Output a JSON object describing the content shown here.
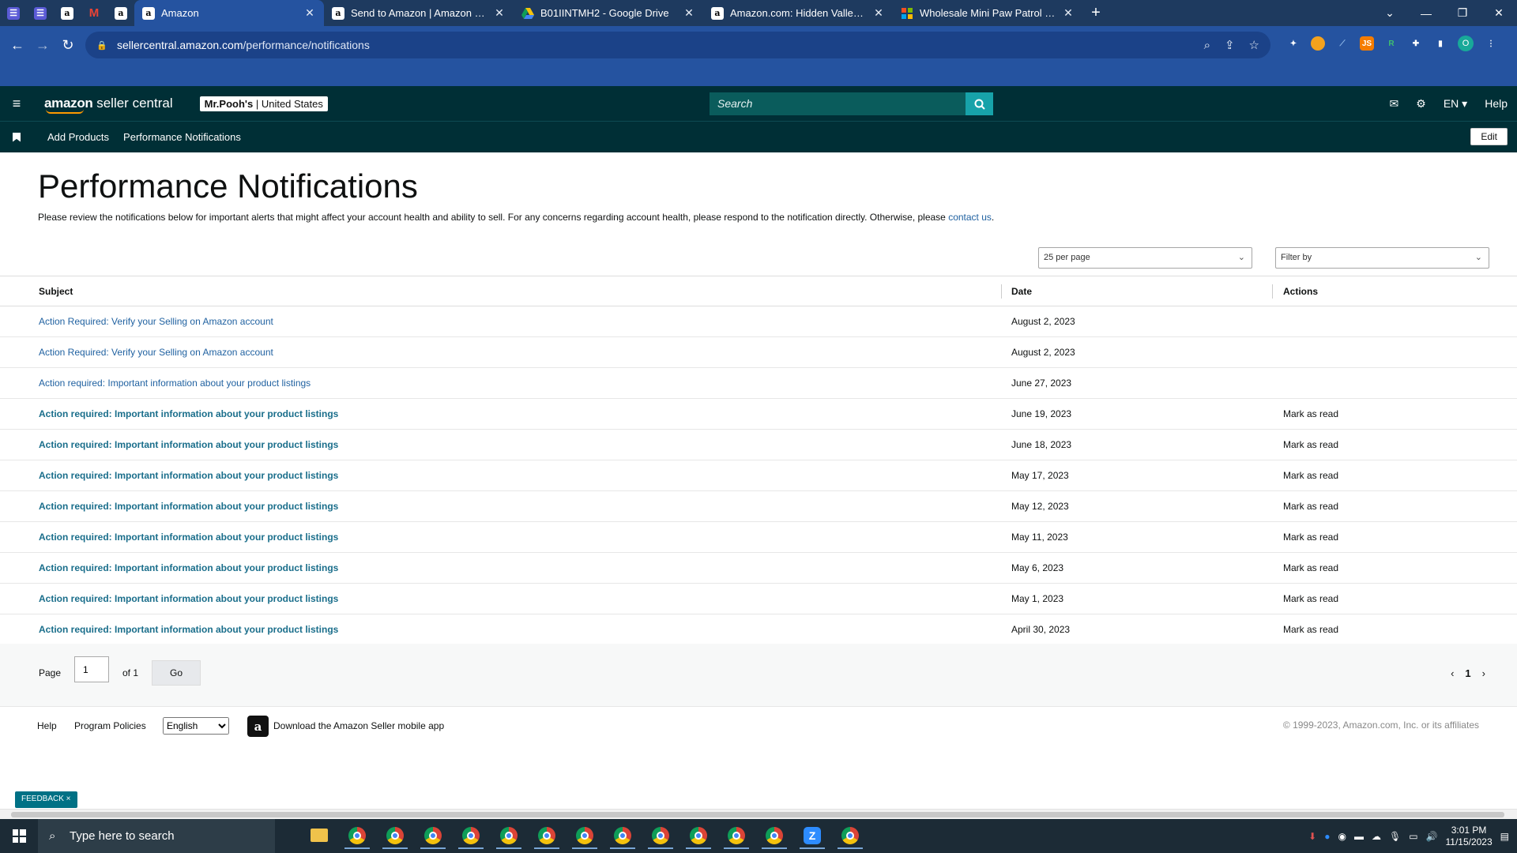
{
  "browser": {
    "tabs": [
      {
        "title": "Amazon",
        "favicon": "amazon-icon",
        "active": true
      },
      {
        "title": "Send to Amazon | Amazon Seller",
        "favicon": "amazon-icon"
      },
      {
        "title": "B01IINTMH2 - Google Drive",
        "favicon": "google-drive-icon"
      },
      {
        "title": "Amazon.com: Hidden Valley, Ran",
        "favicon": "amazon-icon"
      },
      {
        "title": "Wholesale Mini Paw Patrol Guita",
        "favicon": "microsoft-icon"
      }
    ],
    "url_host": "sellercentral.amazon.com",
    "url_path": "/performance/notifications"
  },
  "header": {
    "logo_bold": "amazon",
    "logo_rest": " seller central",
    "store_name": "Mr.Pooh's",
    "store_region": " | United States",
    "search_placeholder": "Search",
    "language": "EN ▾",
    "help": "Help"
  },
  "subnav": {
    "links": [
      "Add Products",
      "Performance Notifications"
    ],
    "edit": "Edit"
  },
  "page": {
    "title": "Performance Notifications",
    "description": "Please review the notifications below for important alerts that might affect your account health and ability to sell. For any concerns regarding account health, please respond to the notification directly. Otherwise, please ",
    "contact_link": "contact us",
    "description_end": "."
  },
  "controls": {
    "per_page": "25 per page",
    "filter": "Filter by"
  },
  "table": {
    "headers": {
      "subject": "Subject",
      "date": "Date",
      "actions": "Actions"
    },
    "rows": [
      {
        "subject": "Action Required: Verify your Selling on Amazon account",
        "date": "August 2, 2023",
        "action": "",
        "unread": false
      },
      {
        "subject": "Action Required: Verify your Selling on Amazon account",
        "date": "August 2, 2023",
        "action": "",
        "unread": false
      },
      {
        "subject": "Action required: Important information about your product listings",
        "date": "June 27, 2023",
        "action": "",
        "unread": false
      },
      {
        "subject": "Action required: Important information about your product listings",
        "date": "June 19, 2023",
        "action": "Mark as read",
        "unread": true
      },
      {
        "subject": "Action required: Important information about your product listings",
        "date": "June 18, 2023",
        "action": "Mark as read",
        "unread": true
      },
      {
        "subject": "Action required: Important information about your product listings",
        "date": "May 17, 2023",
        "action": "Mark as read",
        "unread": true
      },
      {
        "subject": "Action required: Important information about your product listings",
        "date": "May 12, 2023",
        "action": "Mark as read",
        "unread": true
      },
      {
        "subject": "Action required: Important information about your product listings",
        "date": "May 11, 2023",
        "action": "Mark as read",
        "unread": true
      },
      {
        "subject": "Action required: Important information about your product listings",
        "date": "May 6, 2023",
        "action": "Mark as read",
        "unread": true
      },
      {
        "subject": "Action required: Important information about your product listings",
        "date": "May 1, 2023",
        "action": "Mark as read",
        "unread": true
      },
      {
        "subject": "Action required: Important information about your product listings",
        "date": "April 30, 2023",
        "action": "Mark as read",
        "unread": true
      }
    ]
  },
  "pager": {
    "page_label": "Page",
    "page_value": "1",
    "of_label": "of 1",
    "go": "Go",
    "current": "1"
  },
  "footer": {
    "help": "Help",
    "policies": "Program Policies",
    "language": "English",
    "app_text": "Download the Amazon Seller mobile app",
    "copyright": "© 1999-2023, Amazon.com, Inc. or its affiliates",
    "feedback": "FEEDBACK ×"
  },
  "taskbar": {
    "search_placeholder": "Type here to search",
    "time": "3:01 PM",
    "date": "11/15/2023"
  },
  "colors": {
    "header_bg": "#002f36",
    "link": "#2162a1",
    "browser_tab": "#2553a0"
  }
}
